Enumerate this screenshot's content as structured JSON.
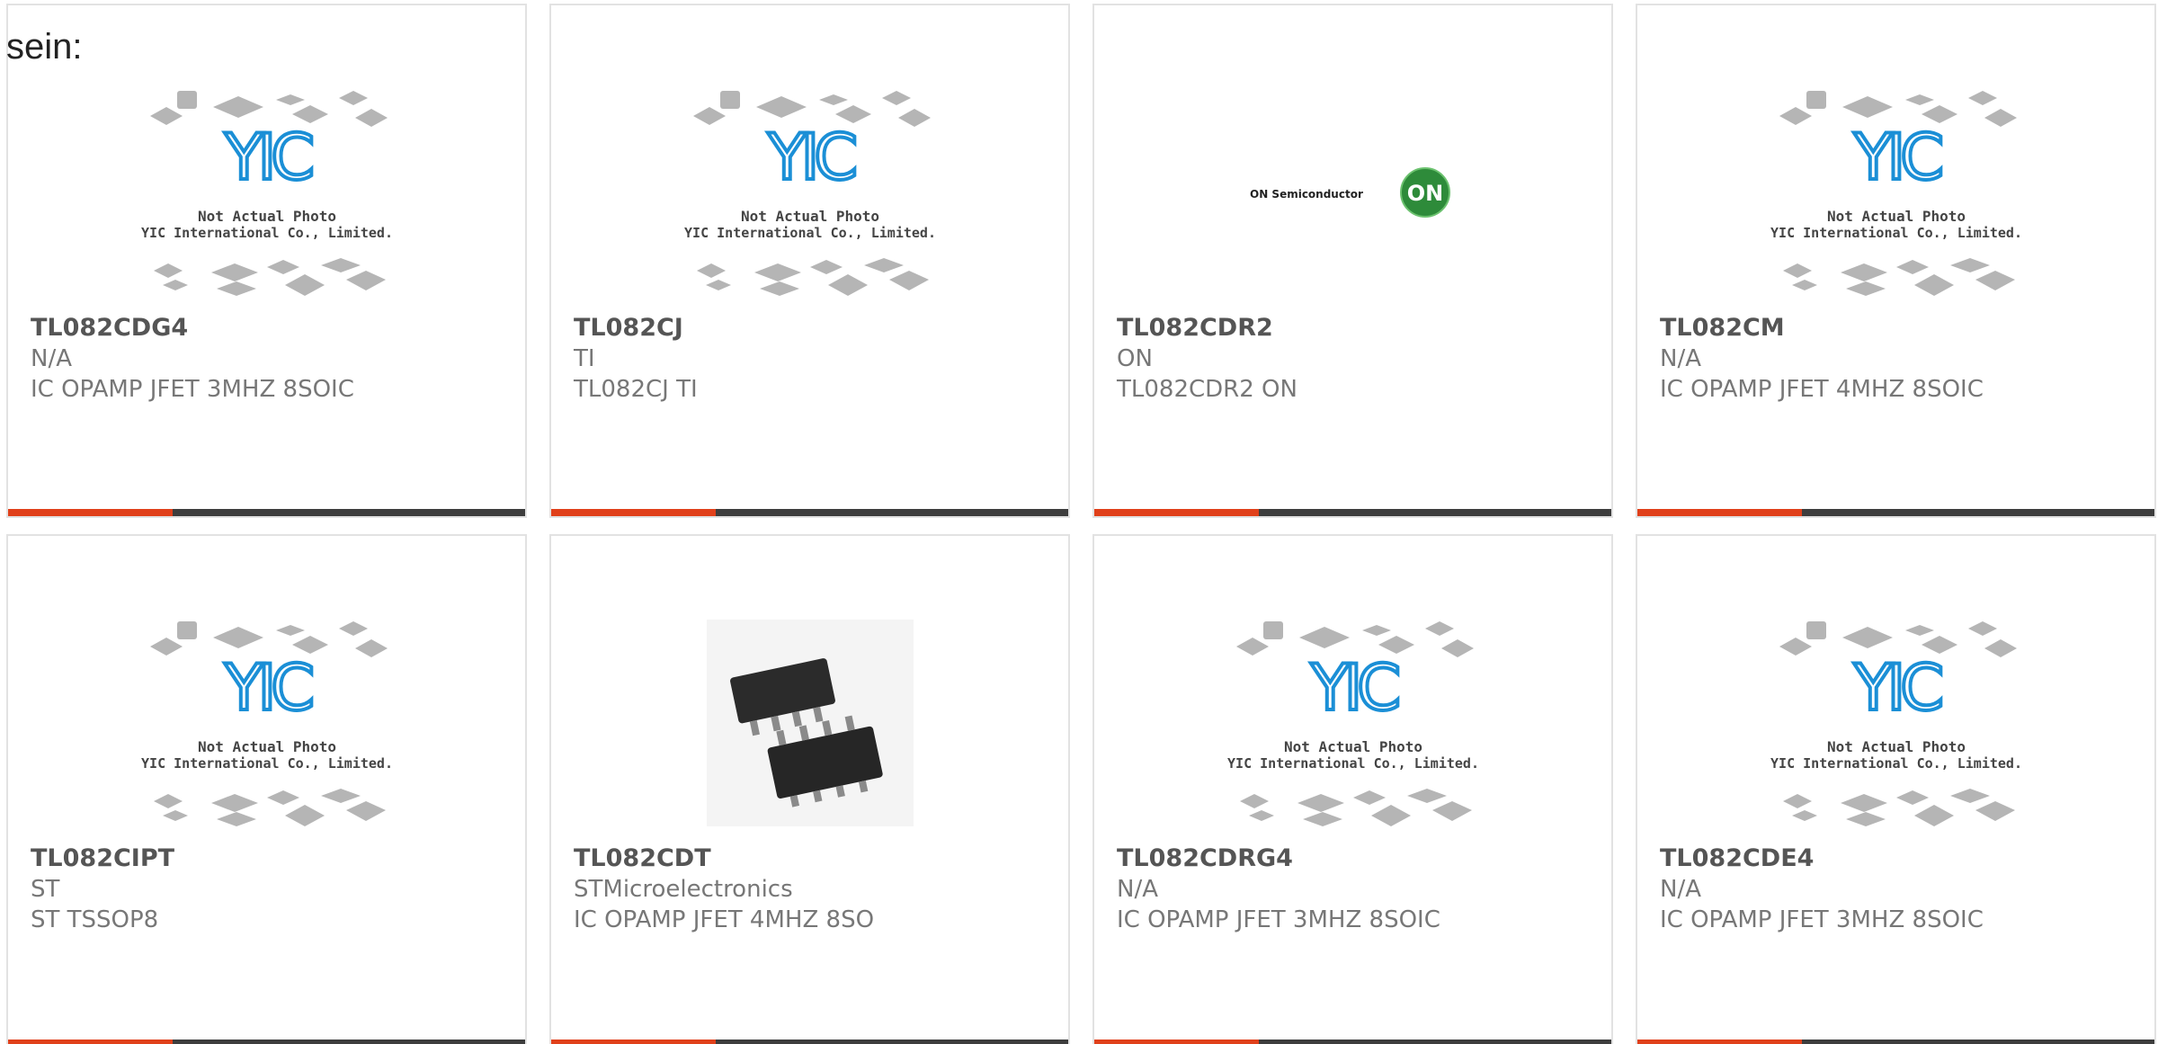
{
  "intro": {
    "text": "sein:"
  },
  "placeholder": {
    "line1": "Not Actual Photo",
    "line2": "YIC International Co., Limited."
  },
  "on_logo": {
    "brand_text": "ON Semiconductor",
    "badge": "ON"
  },
  "colors": {
    "accent": "#e0401a",
    "bar": "#3d3d3d",
    "logo_blue": "#1b8fd6",
    "on_green": "#2e8b3a"
  },
  "products": [
    {
      "part": "TL082CDG4",
      "maker": "N/A",
      "desc": "IC OPAMP JFET 3MHZ 8SOIC",
      "image": "yic-placeholder"
    },
    {
      "part": "TL082CJ",
      "maker": "TI",
      "desc": "TL082CJ TI",
      "image": "yic-placeholder"
    },
    {
      "part": "TL082CDR2",
      "maker": "ON",
      "desc": "TL082CDR2 ON",
      "image": "on-semiconductor-logo"
    },
    {
      "part": "TL082CM",
      "maker": "N/A",
      "desc": "IC OPAMP JFET 4MHZ 8SOIC",
      "image": "yic-placeholder"
    },
    {
      "part": "TL082CIPT",
      "maker": "ST",
      "desc": "ST TSSOP8",
      "image": "yic-placeholder"
    },
    {
      "part": "TL082CDT",
      "maker": "STMicroelectronics",
      "desc": "IC OPAMP JFET 4MHZ 8SO",
      "image": "soic-chip-photo"
    },
    {
      "part": "TL082CDRG4",
      "maker": "N/A",
      "desc": "IC OPAMP JFET 3MHZ 8SOIC",
      "image": "yic-placeholder"
    },
    {
      "part": "TL082CDE4",
      "maker": "N/A",
      "desc": "IC OPAMP JFET 3MHZ 8SOIC",
      "image": "yic-placeholder"
    }
  ]
}
